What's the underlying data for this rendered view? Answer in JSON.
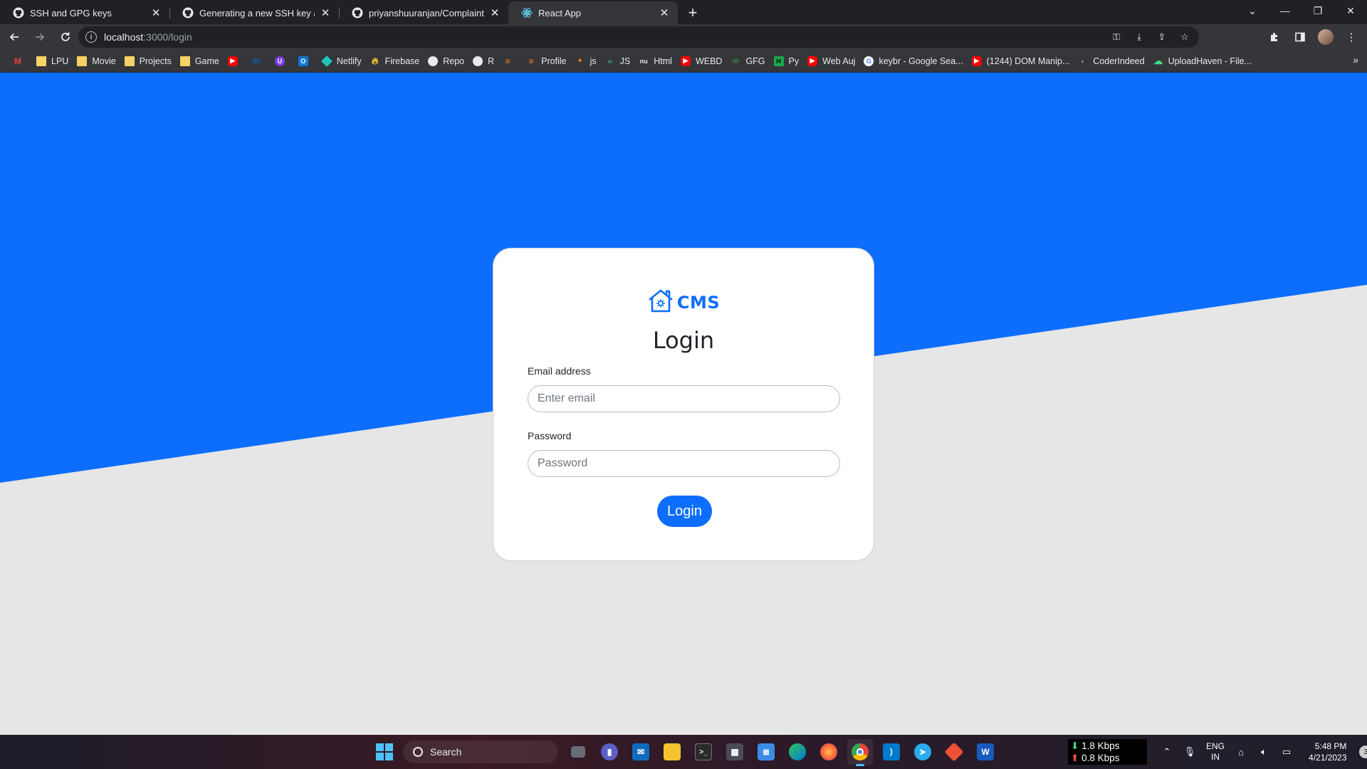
{
  "browser": {
    "tabs": [
      {
        "title": "SSH and GPG keys",
        "icon": "github-icon",
        "active": false
      },
      {
        "title": "Generating a new SSH key and a",
        "icon": "github-icon",
        "active": false
      },
      {
        "title": "priyanshuuranjan/Complaint-Ma",
        "icon": "github-icon",
        "active": false
      },
      {
        "title": "React App",
        "icon": "react-icon",
        "active": true
      }
    ],
    "new_tab_label": "+",
    "address": {
      "host": "localhost",
      "path": ":3000/login"
    },
    "bookmarks": [
      {
        "label": "",
        "icon": "gmail-icon"
      },
      {
        "label": "LPU",
        "icon": "folder-icon"
      },
      {
        "label": "Movie",
        "icon": "folder-icon"
      },
      {
        "label": "Projects",
        "icon": "folder-icon"
      },
      {
        "label": "Game",
        "icon": "folder-icon"
      },
      {
        "label": "",
        "icon": "youtube-icon"
      },
      {
        "label": "",
        "icon": "linkedin-icon"
      },
      {
        "label": "",
        "icon": "extension-u-icon"
      },
      {
        "label": "",
        "icon": "outlook-icon"
      },
      {
        "label": "Netlify",
        "icon": "netlify-icon"
      },
      {
        "label": "Firebase",
        "icon": "firebase-icon"
      },
      {
        "label": "Repo",
        "icon": "github-icon"
      },
      {
        "label": "R",
        "icon": "github-icon"
      },
      {
        "label": "",
        "icon": "stackoverflow-icon"
      },
      {
        "label": "Profile",
        "icon": "stackoverflow-icon"
      },
      {
        "label": "js",
        "icon": "puzzle-icon"
      },
      {
        "label": "JS",
        "icon": "code-icon"
      },
      {
        "label": "Html",
        "icon": "nu-icon"
      },
      {
        "label": "WEBD",
        "icon": "youtube-icon"
      },
      {
        "label": "GFG",
        "icon": "gfg-icon"
      },
      {
        "label": "Py",
        "icon": "hackerrank-icon"
      },
      {
        "label": "Web Auj",
        "icon": "youtube-icon"
      },
      {
        "label": "keybr - Google Sea...",
        "icon": "google-icon"
      },
      {
        "label": "(1244) DOM Manip...",
        "icon": "youtube-icon"
      },
      {
        "label": "CoderIndeed",
        "icon": "coderindeed-icon"
      },
      {
        "label": "UploadHaven - File...",
        "icon": "cloud-icon"
      }
    ]
  },
  "login": {
    "brand": "CMS",
    "title": "Login",
    "email_label": "Email address",
    "email_placeholder": "Enter email",
    "password_label": "Password",
    "password_placeholder": "Password",
    "submit_label": "Login"
  },
  "taskbar": {
    "search_label": "Search",
    "net_down": "1.8 Kbps",
    "net_up": "0.8 Kbps",
    "lang_line1": "ENG",
    "lang_line2": "IN",
    "time": "5:48 PM",
    "date": "4/21/2023",
    "notifications": "3"
  },
  "colors": {
    "primary": "#0d6efd",
    "page_bg": "#e6e6e6",
    "chrome_dark": "#202124",
    "chrome_toolbar": "#35363a"
  }
}
